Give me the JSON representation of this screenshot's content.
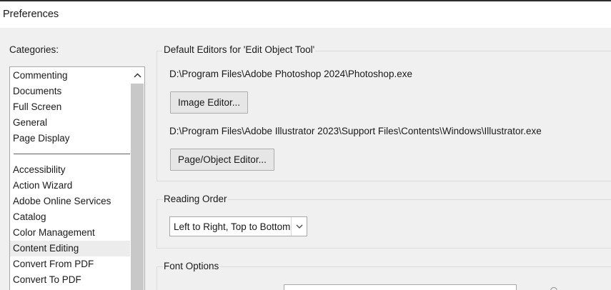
{
  "window": {
    "title": "Preferences"
  },
  "categories": {
    "label": "Categories:",
    "items": [
      {
        "label": "Commenting",
        "selected": false
      },
      {
        "label": "Documents",
        "selected": false
      },
      {
        "label": "Full Screen",
        "selected": false
      },
      {
        "label": "General",
        "selected": false
      },
      {
        "label": "Page Display",
        "selected": false
      },
      {
        "label": "Accessibility",
        "selected": false
      },
      {
        "label": "Action Wizard",
        "selected": false
      },
      {
        "label": "Adobe Online Services",
        "selected": false
      },
      {
        "label": "Catalog",
        "selected": false
      },
      {
        "label": "Color Management",
        "selected": false
      },
      {
        "label": "Content Editing",
        "selected": true
      },
      {
        "label": "Convert From PDF",
        "selected": false
      },
      {
        "label": "Convert To PDF",
        "selected": false
      }
    ]
  },
  "default_editors": {
    "title": "Default Editors for 'Edit Object Tool'",
    "image_editor_path": "D:\\Program Files\\Adobe Photoshop 2024\\Photoshop.exe",
    "image_editor_button": "Image Editor...",
    "page_editor_path": "D:\\Program Files\\Adobe Illustrator 2023\\Support Files\\Contents\\Windows\\Illustrator.exe",
    "page_editor_button": "Page/Object Editor..."
  },
  "reading_order": {
    "title": "Reading Order",
    "selected": "Left to Right, Top to Bottom"
  },
  "font_options": {
    "title": "Font Options"
  },
  "colors": {
    "selection": "#ececec",
    "separator": "#2a6db3",
    "scroll_thumb": "#c8c8c8"
  }
}
